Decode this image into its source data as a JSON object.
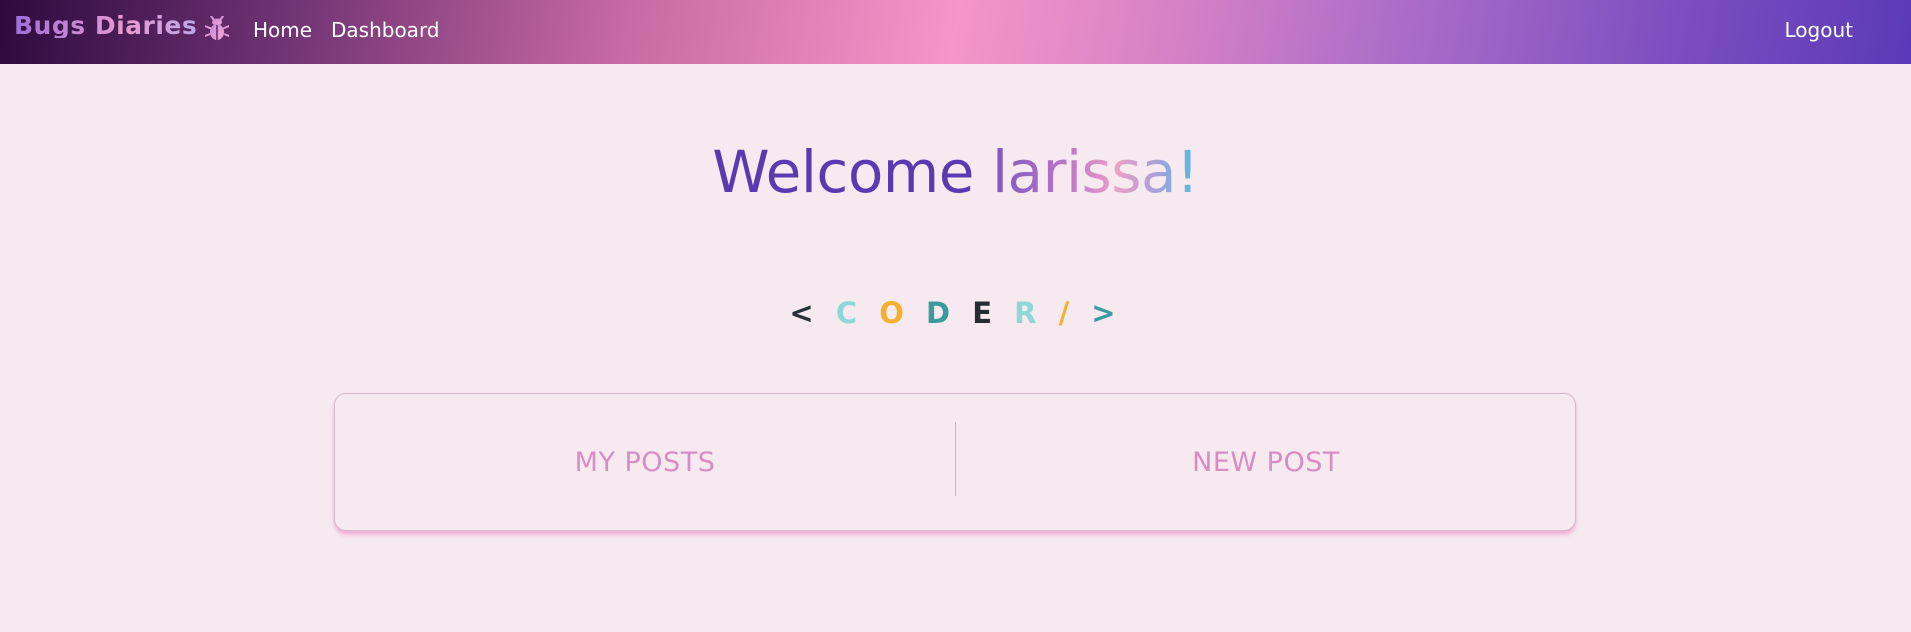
{
  "navbar": {
    "brand": "Bugs Diaries",
    "brand_icon": "ladybug-icon",
    "links": {
      "home": "Home",
      "dashboard": "Dashboard",
      "logout": "Logout"
    }
  },
  "welcome": {
    "prefix": "Welcome ",
    "username": "larissa!"
  },
  "coder_badge": {
    "open": "<",
    "letters": [
      "C",
      "O",
      "D",
      "E",
      "R"
    ],
    "slash": "/",
    "close": ">",
    "colors": {
      "brackets": "#2a3038",
      "C": "#8dd8d4",
      "O": "#f2b230",
      "D": "#3b9aa0",
      "E": "#262c34",
      "R": "#8dd8d4",
      "slash": "#f2b230",
      "close": "#3b9aa0"
    }
  },
  "actions": {
    "my_posts": "MY POSTS",
    "new_post": "NEW POST"
  },
  "colors": {
    "page_background": "#f6eaf0",
    "welcome_text": "#5a3ab0",
    "action_text": "#d98cc4"
  }
}
